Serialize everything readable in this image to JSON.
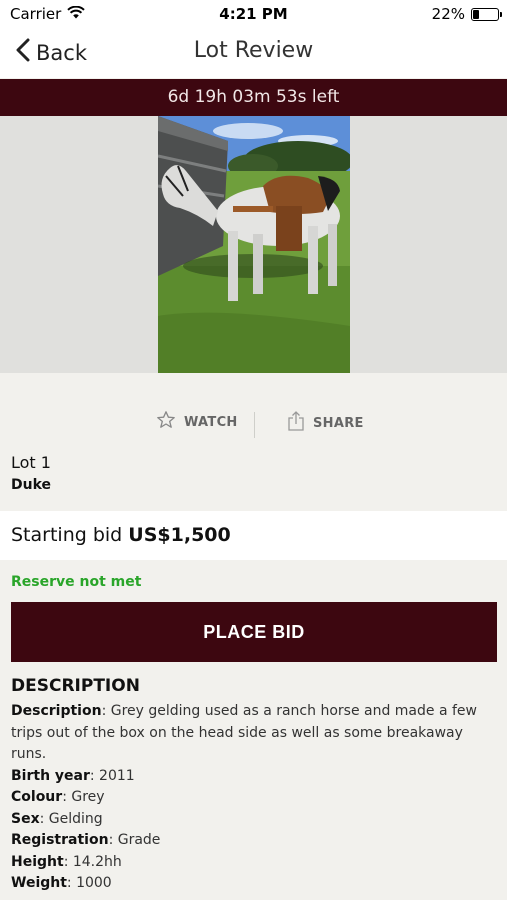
{
  "status_bar": {
    "carrier": "Carrier",
    "time": "4:21 PM",
    "battery_percent": "22%",
    "battery_level": 0.22
  },
  "nav": {
    "back_label": "Back",
    "title": "Lot Review"
  },
  "timer": {
    "text": "6d 19h 03m 53s left"
  },
  "actions": {
    "watch_label": "WATCH",
    "share_label": "SHARE"
  },
  "lot": {
    "number": "Lot 1",
    "name": "Duke"
  },
  "bid": {
    "label": "Starting bid",
    "amount": "US$1,500"
  },
  "reserve_status": "Reserve not met",
  "place_bid_label": "PLACE BID",
  "description": {
    "heading": "DESCRIPTION",
    "fields": [
      {
        "label": "Description",
        "value": ": Grey gelding used as a ranch horse and made a few trips out of the box on the head side as well as some breakaway runs."
      },
      {
        "label": "Birth year",
        "value": ": 2011"
      },
      {
        "label": "Colour",
        "value": ": Grey"
      },
      {
        "label": "Sex",
        "value": ": Gelding"
      },
      {
        "label": "Registration",
        "value": ": Grade"
      },
      {
        "label": "Height",
        "value": ": 14.2hh"
      },
      {
        "label": "Weight",
        "value": ": 1000"
      }
    ]
  },
  "colors": {
    "brand_maroon": "#3d0710",
    "reserve_green": "#2aa52a",
    "page_bg": "#f2f1ed"
  },
  "icons": {
    "wifi": "wifi-icon",
    "battery": "battery-icon",
    "back": "chevron-left-icon",
    "watch": "star-icon",
    "share": "share-icon"
  }
}
